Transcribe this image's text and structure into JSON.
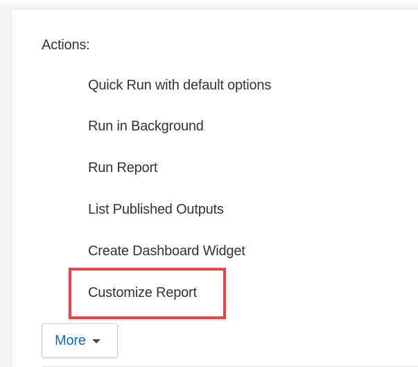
{
  "actions": {
    "label": "Actions:",
    "items": [
      {
        "label": "Quick Run with default options"
      },
      {
        "label": "Run in Background"
      },
      {
        "label": "Run Report"
      },
      {
        "label": "List Published Outputs"
      },
      {
        "label": "Create Dashboard Widget"
      },
      {
        "label": "Customize Report"
      }
    ],
    "highlighted_item": "Customize Report"
  },
  "more_button": {
    "label": "More",
    "icon": "caret-down-icon"
  },
  "colors": {
    "highlight": "#e4454a",
    "link": "#0d6eb8",
    "text": "#333333"
  }
}
